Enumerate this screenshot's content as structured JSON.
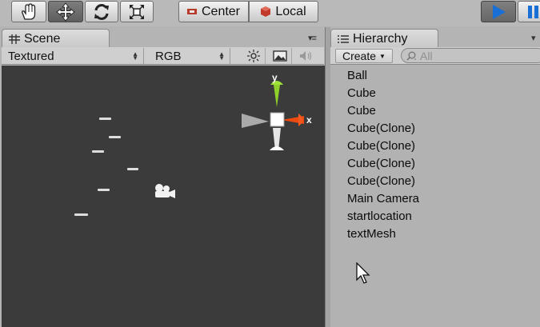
{
  "toolbar": {
    "tools": [
      {
        "name": "hand-tool",
        "icon": "hand-icon",
        "active": false
      },
      {
        "name": "move-tool",
        "icon": "move-arrows-icon",
        "active": true
      },
      {
        "name": "rotate-tool",
        "icon": "rotate-icon",
        "active": false
      },
      {
        "name": "scale-tool",
        "icon": "scale-icon",
        "active": false
      }
    ],
    "pivot_label": "Center",
    "space_label": "Local",
    "play_icon": "play-icon",
    "pause_icon": "pause-icon",
    "accent_color": "#1a6fd6"
  },
  "scene": {
    "tab_label": "Scene",
    "tab_icon": "scene-grid-icon",
    "draw_mode": "Textured",
    "render_mode": "RGB",
    "background_color": "#3b3b3b",
    "gizmo_axes": {
      "y": "y",
      "x": "x"
    },
    "gizmo_colors": {
      "y": "#8fd12a",
      "x": "#f04a10",
      "z": "#e6e6e6"
    }
  },
  "hierarchy": {
    "tab_label": "Hierarchy",
    "tab_icon": "list-icon",
    "create_label": "Create",
    "search_placeholder": "All",
    "items": [
      "Ball",
      "Cube",
      "Cube",
      "Cube(Clone)",
      "Cube(Clone)",
      "Cube(Clone)",
      "Cube(Clone)",
      "Main Camera",
      "startlocation",
      "textMesh"
    ]
  }
}
